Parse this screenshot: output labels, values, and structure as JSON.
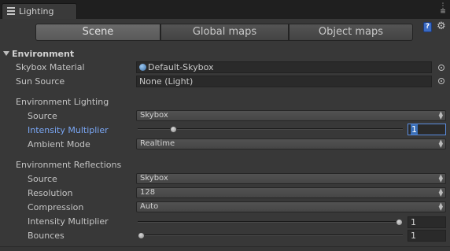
{
  "window": {
    "tab_title": "Lighting"
  },
  "toolbar": {
    "tabs": [
      "Scene",
      "Global maps",
      "Object maps"
    ],
    "active_tab": "Scene"
  },
  "environment": {
    "header": "Environment",
    "skybox_material_label": "Skybox Material",
    "skybox_material_value": "Default-Skybox",
    "sun_source_label": "Sun Source",
    "sun_source_value": "None (Light)"
  },
  "environment_lighting": {
    "header": "Environment Lighting",
    "source_label": "Source",
    "source_value": "Skybox",
    "intensity_label": "Intensity Multiplier",
    "intensity_value": "1",
    "intensity_fraction": 0.125,
    "ambient_mode_label": "Ambient Mode",
    "ambient_mode_value": "Realtime"
  },
  "environment_reflections": {
    "header": "Environment Reflections",
    "source_label": "Source",
    "source_value": "Skybox",
    "resolution_label": "Resolution",
    "resolution_value": "128",
    "compression_label": "Compression",
    "compression_value": "Auto",
    "intensity_label": "Intensity Multiplier",
    "intensity_value": "1",
    "intensity_fraction": 1.0,
    "bounces_label": "Bounces",
    "bounces_value": "1",
    "bounces_fraction": 0.0
  },
  "colors": {
    "background": "#383838",
    "highlight_label": "#7aa7f5",
    "selection": "#3a6fb7"
  }
}
